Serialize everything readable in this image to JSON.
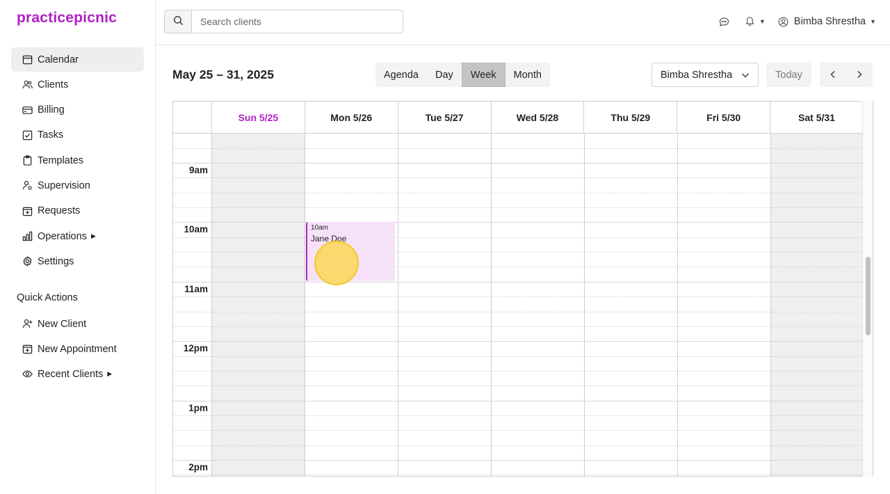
{
  "brand": {
    "logo": "practicepicnic",
    "accent": "#b01fc4"
  },
  "sidebar": {
    "items": [
      {
        "label": "Calendar",
        "icon": "calendar-icon",
        "active": true
      },
      {
        "label": "Clients",
        "icon": "users-icon"
      },
      {
        "label": "Billing",
        "icon": "credit-card-icon"
      },
      {
        "label": "Tasks",
        "icon": "checkbox-icon"
      },
      {
        "label": "Templates",
        "icon": "clipboard-icon"
      },
      {
        "label": "Supervision",
        "icon": "user-gear-icon"
      },
      {
        "label": "Requests",
        "icon": "calendar-plus-icon"
      },
      {
        "label": "Operations",
        "icon": "bar-chart-icon",
        "has_submenu": true
      },
      {
        "label": "Settings",
        "icon": "gear-icon"
      }
    ],
    "quick_actions_title": "Quick Actions",
    "quick_actions": [
      {
        "label": "New Client",
        "icon": "user-plus-icon"
      },
      {
        "label": "New Appointment",
        "icon": "calendar-plus-icon"
      },
      {
        "label": "Recent Clients",
        "icon": "eye-icon",
        "has_submenu": true
      }
    ]
  },
  "topbar": {
    "search_placeholder": "Search clients",
    "user_name": "Bimba Shrestha"
  },
  "calendar": {
    "range_title": "May 25 – 31, 2025",
    "views": [
      {
        "label": "Agenda"
      },
      {
        "label": "Day"
      },
      {
        "label": "Week",
        "active": true
      },
      {
        "label": "Month"
      }
    ],
    "provider": "Bimba Shrestha",
    "today_label": "Today",
    "days": [
      {
        "label": "Sun 5/25",
        "today": true,
        "off": true
      },
      {
        "label": "Mon 5/26"
      },
      {
        "label": "Tue 5/27"
      },
      {
        "label": "Wed 5/28"
      },
      {
        "label": "Thu 5/29"
      },
      {
        "label": "Fri 5/30"
      },
      {
        "label": "Sat 5/31",
        "off": true
      }
    ],
    "hours": [
      "9am",
      "10am",
      "11am",
      "12pm",
      "1pm",
      "2pm"
    ],
    "event": {
      "time": "10am",
      "name": "Jane Doe",
      "day": "Mon 5/26"
    }
  }
}
